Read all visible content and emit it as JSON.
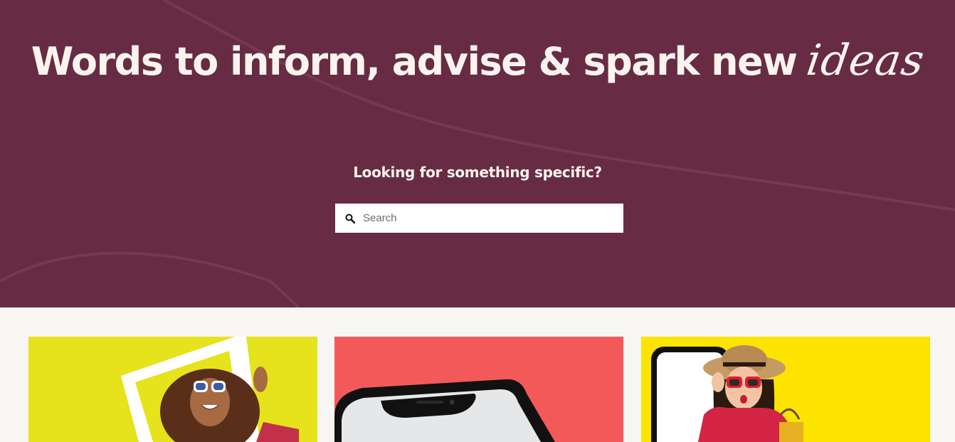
{
  "hero": {
    "headline_main": "Words to inform, advise & spark new",
    "headline_script": "ideas",
    "subheading": "Looking for something specific?",
    "background_color": "#672c43",
    "text_color": "#fbf4ee"
  },
  "search": {
    "placeholder": "Search",
    "value": "",
    "icon": "search-icon"
  },
  "cards": [
    {
      "name": "article-card-1",
      "background": "#e6e21c",
      "image": "woman-with-sunglasses-photo-frame"
    },
    {
      "name": "article-card-2",
      "background": "#f4595a",
      "image": "smartphone-closeup"
    },
    {
      "name": "article-card-3",
      "background": "#fde400",
      "image": "woman-with-hat-and-red-sunglasses-shopping"
    }
  ]
}
